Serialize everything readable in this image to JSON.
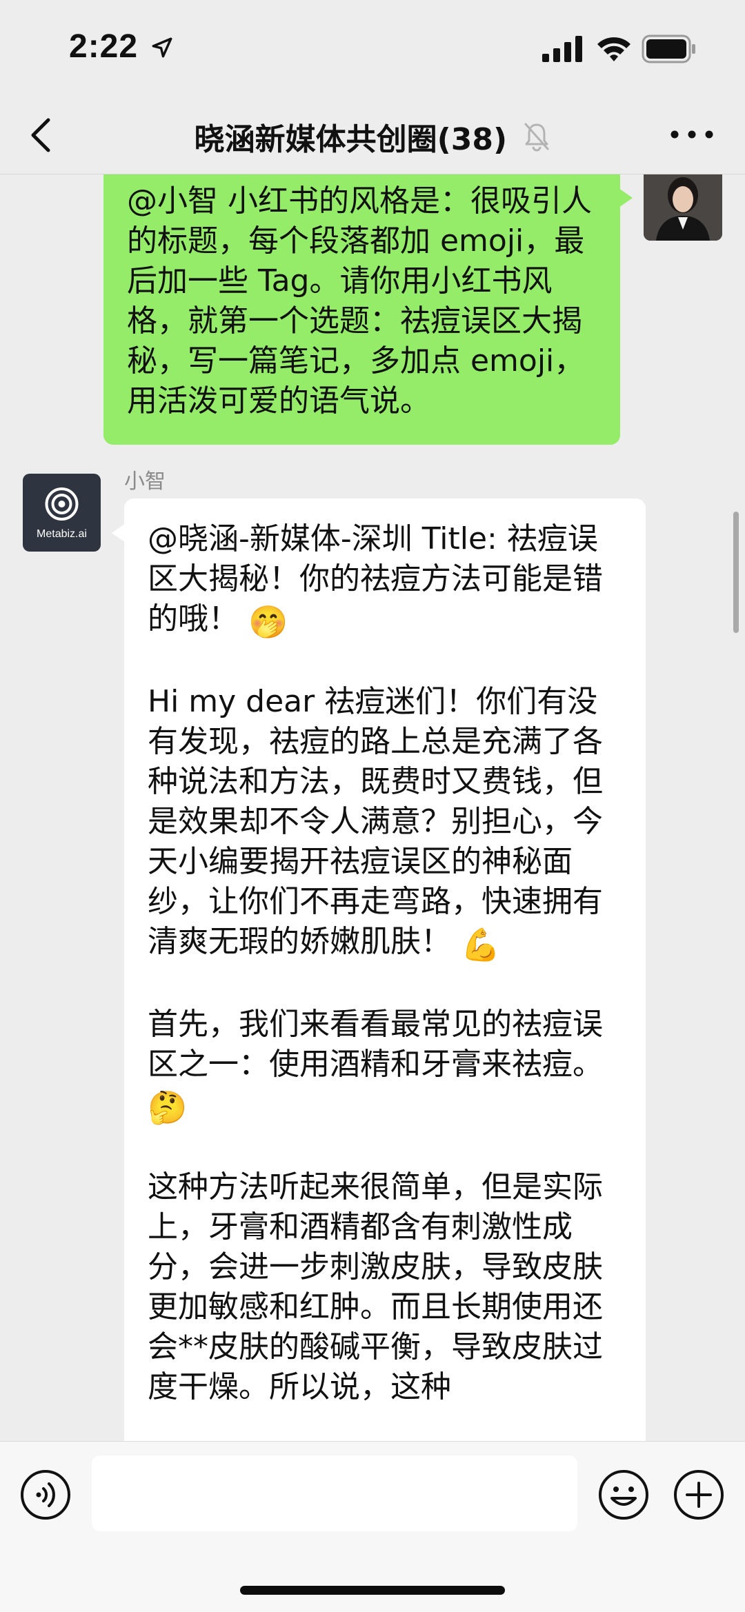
{
  "status_bar": {
    "time": "2:22",
    "icons": [
      "location-arrow-icon",
      "cellular-signal-icon",
      "wifi-icon",
      "battery-icon"
    ]
  },
  "nav": {
    "title": "晓涵新媒体共创圈(38)",
    "icons": [
      "back-chevron-icon",
      "mute-bell-icon",
      "more-dots-icon"
    ]
  },
  "messages": {
    "outgoing": {
      "text": "@小智 小红书的风格是：很吸引人的标题，每个段落都加 emoji，最后加一些 Tag。请你用小红书风格，就第一个选题：祛痘误区大揭秘，写一篇笔记，多加点 emoji，用活泼可爱的语气说。"
    },
    "incoming": {
      "sender": "小智",
      "avatar_label": "Metabiz.ai",
      "paragraphs": [
        {
          "text": "@晓涵-新媒体-深圳 Title: 祛痘误区大揭秘！你的祛痘方法可能是错的哦！",
          "emoji": "🤭"
        },
        {
          "text": "Hi my dear 祛痘迷们！你们有没有发现，祛痘的路上总是充满了各种说法和方法，既费时又费钱，但是效果却不令人满意？别担心，今天小编要揭开祛痘误区的神秘面纱，让你们不再走弯路，快速拥有清爽无瑕的娇嫩肌肤！",
          "emoji": "💪"
        },
        {
          "text": "首先，我们来看看最常见的祛痘误区之一：使用酒精和牙膏来祛痘。",
          "emoji": "🤔"
        },
        {
          "text": "这种方法听起来很简单，但是实际上，牙膏和酒精都含有刺激性成分，会进一步刺激皮肤，导致皮肤更加敏感和红肿。而且长期使用还会**皮肤的酸碱平衡，导致皮肤过度干燥。所以说，这种",
          "emoji": ""
        }
      ]
    }
  },
  "input_bar": {
    "value": "",
    "icons": [
      "voice-icon",
      "emoji-face-icon",
      "plus-icon"
    ]
  },
  "colors": {
    "background": "#ededed",
    "outgoing_bubble": "#95ec69",
    "incoming_bubble": "#ffffff",
    "bot_avatar": "#2f3441"
  }
}
